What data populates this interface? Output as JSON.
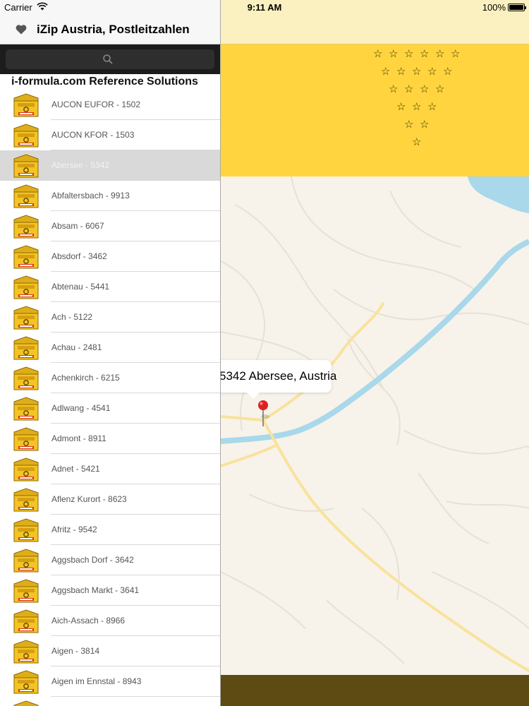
{
  "status": {
    "carrier": "Carrier",
    "time": "9:11 AM",
    "battery": "100%"
  },
  "nav": {
    "title": "iZip Austria, Postleitzahlen"
  },
  "search": {
    "placeholder": ""
  },
  "section": {
    "header": "i-formula.com Reference Solutions"
  },
  "list": {
    "selected_index": 2,
    "items": [
      "AUCON EUFOR - 1502",
      "AUCON KFOR - 1503",
      "Abersee - 5342",
      "Abfaltersbach - 9913",
      "Absam - 6067",
      "Absdorf - 3462",
      "Abtenau - 5441",
      "Ach - 5122",
      "Achau - 2481",
      "Achenkirch - 6215",
      "Adlwang - 4541",
      "Admont - 8911",
      "Adnet - 5421",
      "Aflenz Kurort - 8623",
      "Afritz - 9542",
      "Aggsbach Dorf - 3642",
      "Aggsbach Markt - 3641",
      "Aich-Assach - 8966",
      "Aigen - 3814",
      "Aigen im Ennstal - 8943",
      ""
    ]
  },
  "map": {
    "callout": "5342 Abersee, Austria"
  },
  "colors": {
    "flag_yellow": "#ffd43e",
    "water": "#a8d8ea",
    "road": "#f9e29b",
    "pin": "#e02020"
  },
  "icons": {
    "favorite": "heart-icon",
    "search": "search-icon",
    "row": "mailbox-icon",
    "marker": "map-pin-icon"
  }
}
